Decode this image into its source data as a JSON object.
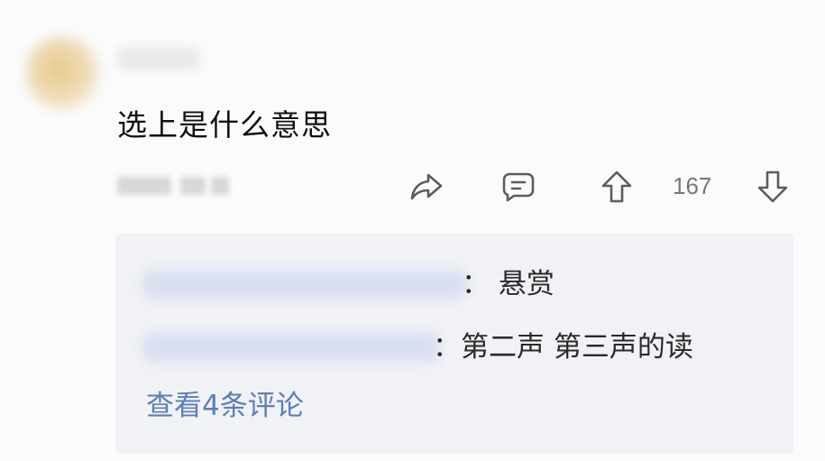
{
  "post": {
    "question": "选上是什么意思"
  },
  "actions": {
    "share_icon": "share-arrow-icon",
    "comment_icon": "comment-icon",
    "upvote_icon": "up-arrow-icon",
    "downvote_icon": "down-arrow-icon",
    "vote_count": "167"
  },
  "replies": {
    "items": [
      {
        "text": "： 悬赏"
      },
      {
        "text": "：第二声 第三声的读"
      }
    ],
    "view_more": "查看4条评论"
  }
}
